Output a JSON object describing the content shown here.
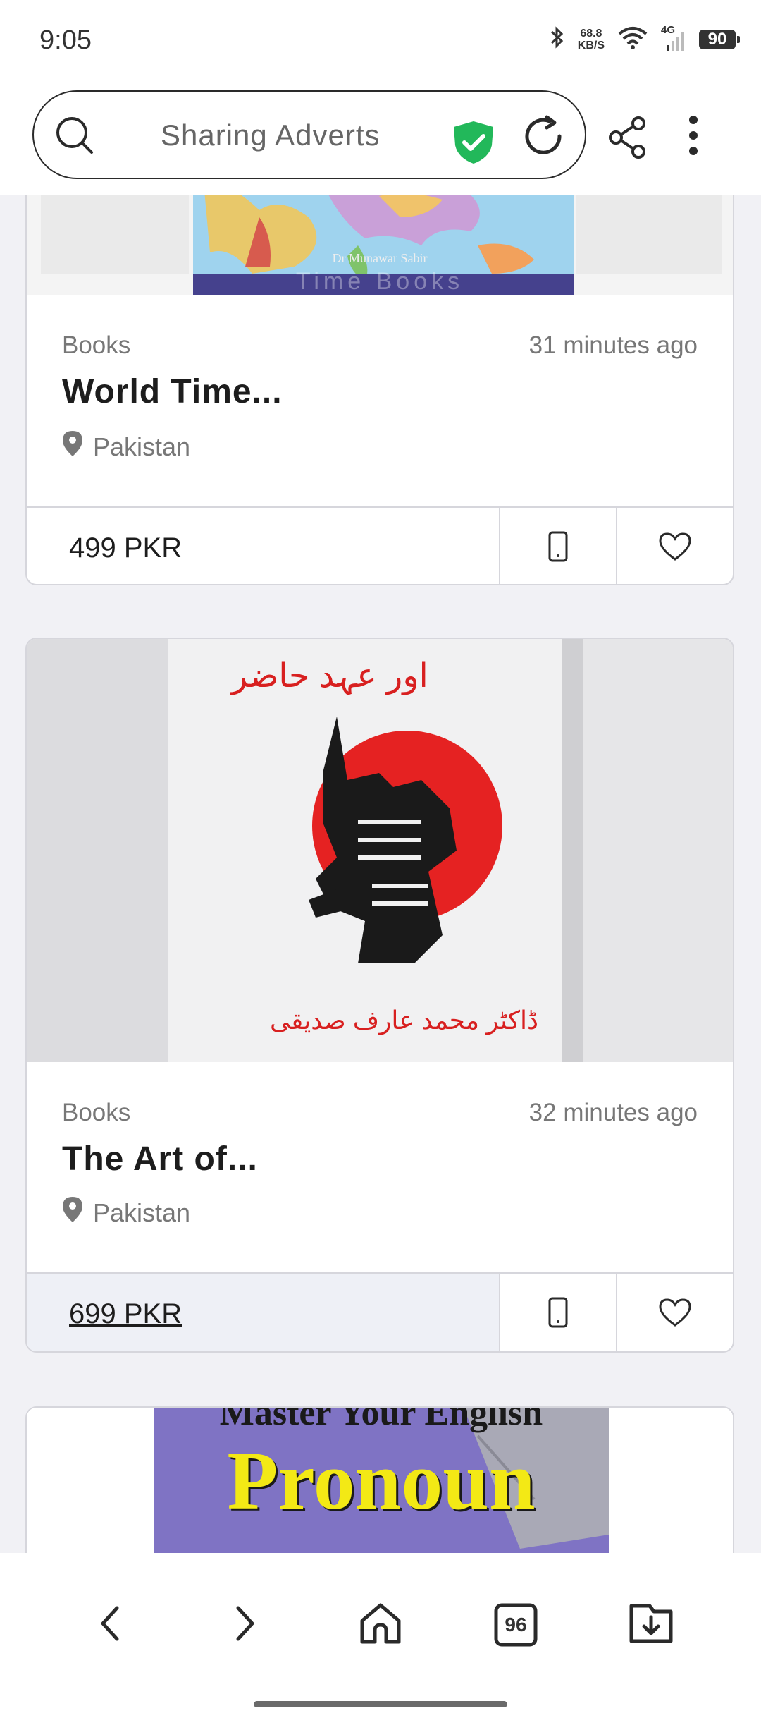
{
  "status_bar": {
    "time": "9:05",
    "net_speed_value": "68.8",
    "net_speed_unit": "KB/S",
    "network_type": "4G",
    "battery": "90"
  },
  "browser": {
    "site_title": "Sharing Adverts",
    "tab_count": "96"
  },
  "listings": [
    {
      "category": "Books",
      "time_ago": "31 minutes ago",
      "title": "World Time...",
      "location": "Pakistan",
      "price": "499 PKR",
      "image_caption": "Dr Munawar Sabir",
      "image_faded_text": "Time Books"
    },
    {
      "category": "Books",
      "time_ago": "32 minutes ago",
      "title": "The Art of...",
      "location": "Pakistan",
      "price": "699 PKR",
      "image_text_top": "اور عہد حاضر",
      "image_text_bottom": "ڈاکٹر محمد عارف صدیقی"
    },
    {
      "image_text_top": "Master Your English",
      "image_text_main": "Pronoun"
    }
  ],
  "colors": {
    "shield_green": "#22b85a",
    "price_highlight": "#eef0f6",
    "sun_red": "#e52222",
    "book_purple": "#7f73c4",
    "pronoun_yellow": "#f3e915"
  }
}
